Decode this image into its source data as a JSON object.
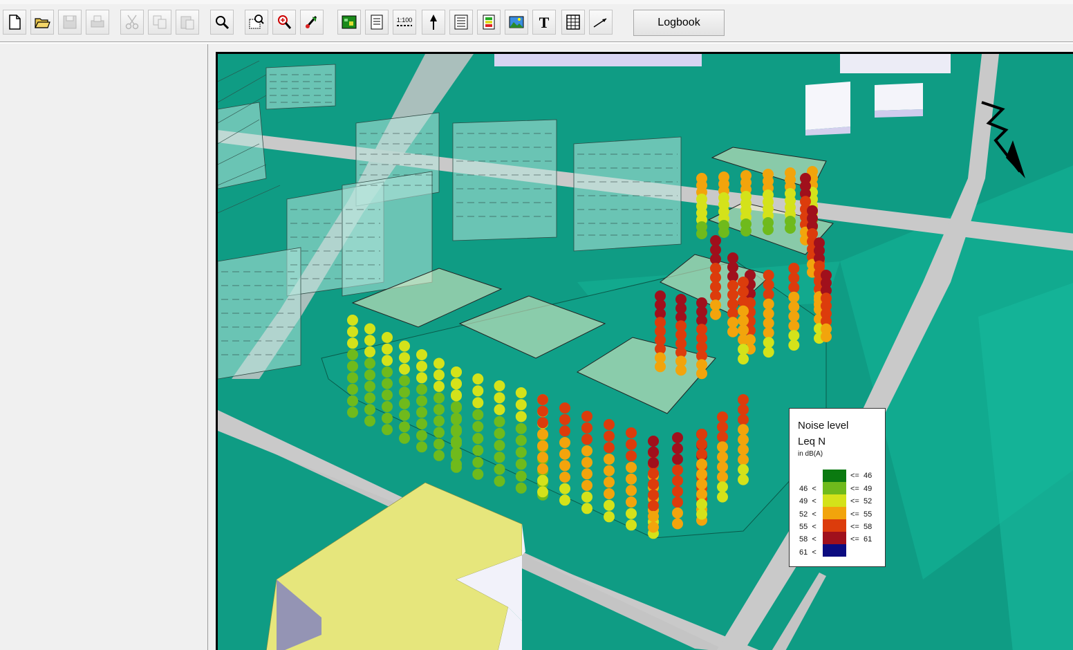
{
  "toolbar": {
    "buttons": [
      {
        "icon": "new-file-icon"
      },
      {
        "icon": "open-folder-icon"
      },
      {
        "icon": "save-icon"
      },
      {
        "icon": "print-icon"
      },
      {
        "icon": "cut-icon"
      },
      {
        "icon": "copy-icon"
      },
      {
        "icon": "paste-icon"
      },
      {
        "icon": "zoom-icon"
      },
      {
        "icon": "zoom-window-icon"
      },
      {
        "icon": "zoom-detail-icon"
      },
      {
        "icon": "edit-color-icon"
      },
      {
        "icon": "map-view-icon"
      },
      {
        "icon": "document-list-icon"
      },
      {
        "icon": "scale-icon",
        "label": "1:100"
      },
      {
        "icon": "north-arrow-icon"
      },
      {
        "icon": "text-list-icon"
      },
      {
        "icon": "legend-icon"
      },
      {
        "icon": "picture-icon"
      },
      {
        "icon": "text-icon",
        "label": "T"
      },
      {
        "icon": "table-icon"
      },
      {
        "icon": "arrow-icon"
      }
    ],
    "logbook_label": "Logbook"
  },
  "legend": {
    "title": "Noise level",
    "subtitle": "Leq N",
    "unit": "in dB(A)",
    "classes": [
      {
        "low": "",
        "high": "<=  46",
        "color": "#0b7a10"
      },
      {
        "low": "46  <",
        "high": "<=  49",
        "color": "#6fba1c"
      },
      {
        "low": "49  <",
        "high": "<=  52",
        "color": "#d4e21a"
      },
      {
        "low": "52  <",
        "high": "<=  55",
        "color": "#f2a40c"
      },
      {
        "low": "55  <",
        "high": "<=  58",
        "color": "#dc3c0c"
      },
      {
        "low": "58  <",
        "high": "<=  61",
        "color": "#a0101c"
      },
      {
        "low": "61  <",
        "high": "",
        "color": "#0c0c80"
      }
    ]
  },
  "colors": {
    "terrain": "#0f9c84",
    "road": "#c8c8c8",
    "highlight_building": "#e6e67c"
  }
}
